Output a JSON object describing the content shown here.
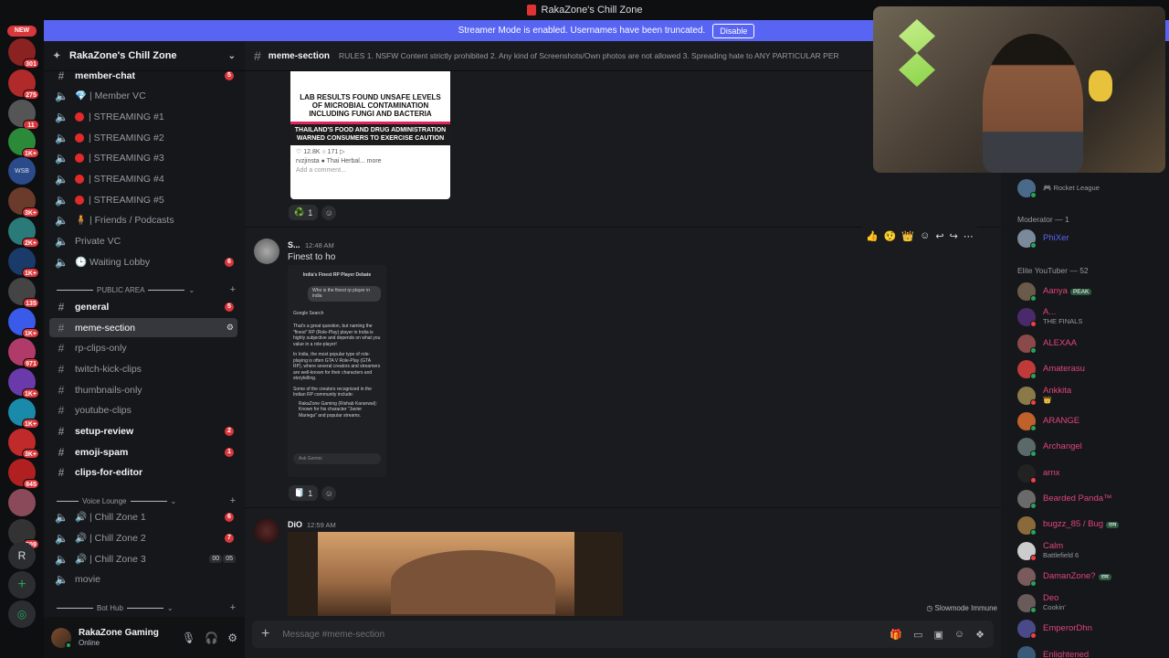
{
  "window": {
    "title": "RakaZone's Chill Zone"
  },
  "streamer_banner": {
    "text": "Streamer Mode is enabled. Usernames have been truncated.",
    "button": "Disable"
  },
  "server_rail": {
    "new_pill": "NEW",
    "badges": [
      "301",
      "275",
      "11",
      "1K+",
      "WSB",
      "3K+",
      "2K+",
      "1K+",
      "135",
      "1K+",
      "971",
      "1K+",
      "1K+",
      "3K+",
      "845",
      "509"
    ],
    "letter_server": "R"
  },
  "sidebar": {
    "guild_name": "RakaZone's Chill Zone",
    "channels_top": [
      {
        "label": "member-chat",
        "mention": "5",
        "type": "text",
        "bold": true
      },
      {
        "label": "💎 | Member VC",
        "type": "voice"
      },
      {
        "label": "| STREAMING #1",
        "type": "voice-live"
      },
      {
        "label": "| STREAMING #2",
        "type": "voice-live"
      },
      {
        "label": "| STREAMING #3",
        "type": "voice-live"
      },
      {
        "label": "| STREAMING #4",
        "type": "voice-live"
      },
      {
        "label": "| STREAMING #5",
        "type": "voice-live"
      },
      {
        "label": "🧍 | Friends / Podcasts",
        "type": "voice"
      },
      {
        "label": "Private VC",
        "type": "voice"
      },
      {
        "label": "🕒 Waiting Lobby",
        "mention": "6",
        "type": "voice"
      }
    ],
    "category_public": "PUBLIC AREA",
    "channels_public": [
      {
        "label": "general",
        "mention": "5",
        "bold": true
      },
      {
        "label": "meme-section",
        "selected": true
      },
      {
        "label": "rp-clips-only"
      },
      {
        "label": "twitch-kick-clips"
      },
      {
        "label": "thumbnails-only"
      },
      {
        "label": "youtube-clips"
      },
      {
        "label": "setup-review",
        "mention": "2",
        "bold": true
      },
      {
        "label": "emoji-spam",
        "mention": "1",
        "bold": true
      },
      {
        "label": "clips-for-editor",
        "bold": true
      }
    ],
    "category_voice": "Voice Lounge",
    "channels_voice": [
      {
        "label": "🔊 | Chill Zone 1",
        "mention": "6"
      },
      {
        "label": "🔊 | Chill Zone 2",
        "mention": "7"
      },
      {
        "label": "🔊 | Chill Zone 3",
        "users": [
          "00",
          "05"
        ]
      },
      {
        "label": "movie"
      }
    ],
    "category_bot": "Bot Hub"
  },
  "user_panel": {
    "name": "RakaZone Gaming",
    "status": "Online"
  },
  "channel_header": {
    "name": "meme-section",
    "topic": "RULES 1. NSFW Content strictly prohibited 2. Any kind of Screenshots/Own photos are not allowed 3. Spreading hate to ANY PARTICULAR PER"
  },
  "messages": {
    "img1": {
      "text_top": "LAB RESULTS FOUND UNSAFE LEVELS OF MICROBIAL CONTAMINATION INCLUDING FUNGI AND BACTERIA",
      "text_bottom": "THAILAND'S FOOD AND DRUG ADMINISTRATION WARNED CONSUMERS TO EXERCISE CAUTION",
      "ig_stats": "♡ 12.8K  ○ 171  ▷",
      "ig_caption": "rvzjinsta ● Thai Herbal... more",
      "ig_comment": "Add a comment..."
    },
    "reaction1": {
      "emoji": "♻️",
      "count": "1"
    },
    "msg2": {
      "author": "S...",
      "time": "12:48 AM",
      "body": "Finest to ho",
      "phone": {
        "title": "India's Finest RP Player Debate",
        "question": "Who is the finest rp player in india",
        "source": "Google Search",
        "answer1": "That's a great question, but naming the \"finest\" RP (Role-Play) player in India is highly subjective and depends on what you value in a role-player!",
        "answer2": "In India, the most popular type of role-playing is often GTA V Role-Play (GTA RP), where several creators and streamers are well-known for their characters and storytelling.",
        "answer3": "Some of the creators recognized in the Indian RP community include:",
        "answer4": "RakaZone Gaming (Rishab Karanwal): Known for his character \"Javier Mariega\" and popular streams.",
        "ask": "Ask Gemini"
      }
    },
    "reaction2": {
      "emoji": "🧻",
      "count": "1"
    },
    "msg3": {
      "author": "DiO",
      "time": "12:59 AM"
    },
    "slowmode": "Slowmode Immune"
  },
  "hover_toolbar": {
    "icons": [
      "👍",
      "🤨",
      "👑",
      "add-reaction-icon",
      "reply-icon",
      "forward-icon",
      "more-icon"
    ]
  },
  "composer": {
    "placeholder": "Message #meme-section"
  },
  "members": {
    "top_member": {
      "sub": "Rocket League"
    },
    "group_mod": "Moderator — 1",
    "mod": {
      "name": "PhiXer"
    },
    "group_elite": "Elite YouTuber — 52",
    "list": [
      {
        "name": "Aanya",
        "tag": "PEAK"
      },
      {
        "name": "A...",
        "sub": "THE FINALS"
      },
      {
        "name": "ALEXAA"
      },
      {
        "name": "Amaterasu"
      },
      {
        "name": "Ankkita",
        "sub": "👑"
      },
      {
        "name": "ARANGE"
      },
      {
        "name": "Archangel"
      },
      {
        "name": "arnx"
      },
      {
        "name": "Bearded Panda™"
      },
      {
        "name": "bugzz_85 / Bug",
        "tag": "राम"
      },
      {
        "name": "Calm",
        "sub": "Battlefield 6"
      },
      {
        "name": "DamanZone?",
        "tag": "राम"
      },
      {
        "name": "Deo",
        "sub": "Cookin'"
      },
      {
        "name": "EmperorDhn"
      },
      {
        "name": "Enlightened"
      }
    ]
  },
  "colors": {
    "blurple": "#5865f2",
    "mention_red": "#da373c",
    "online": "#23a55a",
    "link": "#5865f2",
    "member_name": "#e0457a"
  }
}
